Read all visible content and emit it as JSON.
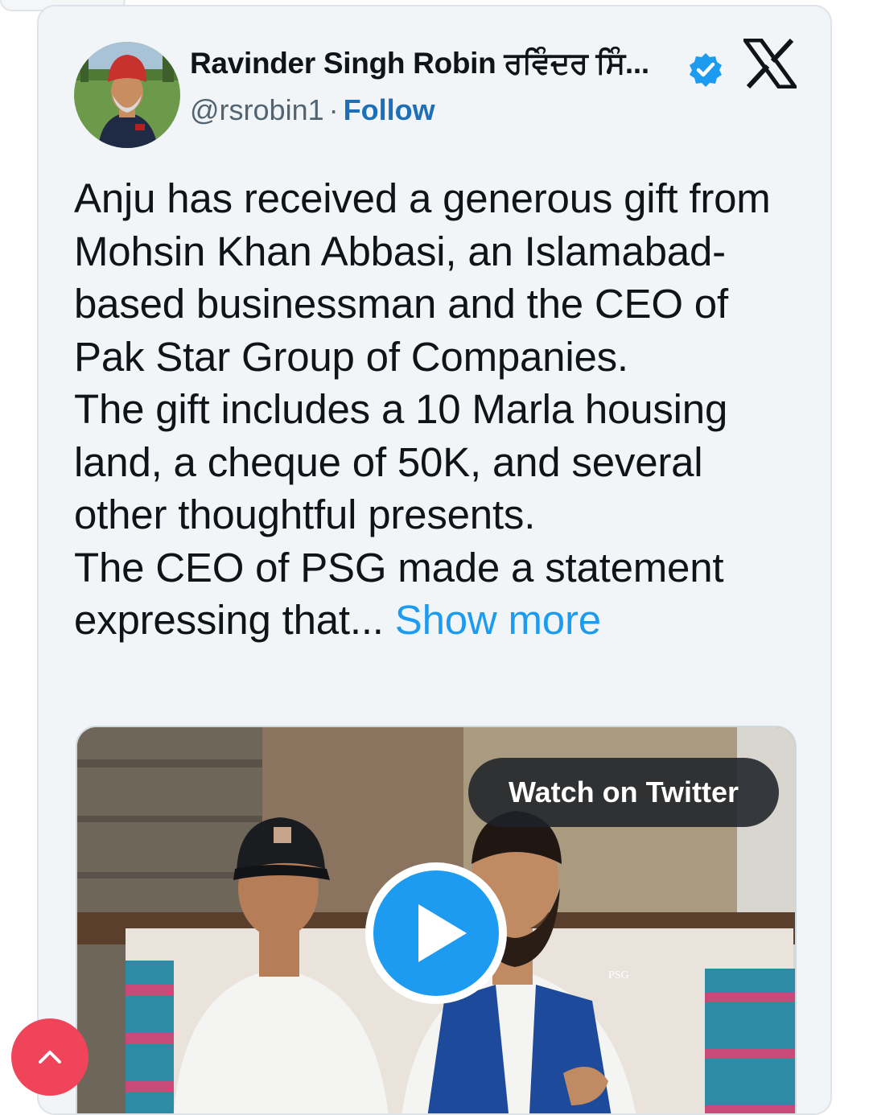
{
  "tweet": {
    "author_name": "Ravinder Singh Robin ਰਵਿੰਦਰ ਸਿੰ...",
    "handle": "@rsrobin1",
    "separator": "·",
    "follow_label": "Follow",
    "text_paragraphs": [
      "Anju has received a generous gift from Mohsin Khan Abbasi, an Islamabad-based businessman and the CEO of Pak Star Group of Companies.",
      "The gift includes a 10 Marla housing land, a cheque of 50K, and several other thoughtful presents.",
      "The CEO of PSG made a statement expressing that..."
    ],
    "show_more_label": "Show more"
  },
  "media": {
    "watch_label": "Watch on Twitter",
    "vest_logo_text": "PSG"
  },
  "colors": {
    "card_bg": "#f2f5f8",
    "link_blue": "#1d9bf0",
    "follow_blue": "#1d6fb8",
    "verified_blue": "#1d9bf0",
    "play_blue": "#1d9bf0",
    "scroll_button": "#f0445a"
  },
  "icons": {
    "verified": "verified-badge-icon",
    "platform": "x-logo-icon",
    "play": "play-icon",
    "scroll_top": "chevron-up-icon"
  }
}
